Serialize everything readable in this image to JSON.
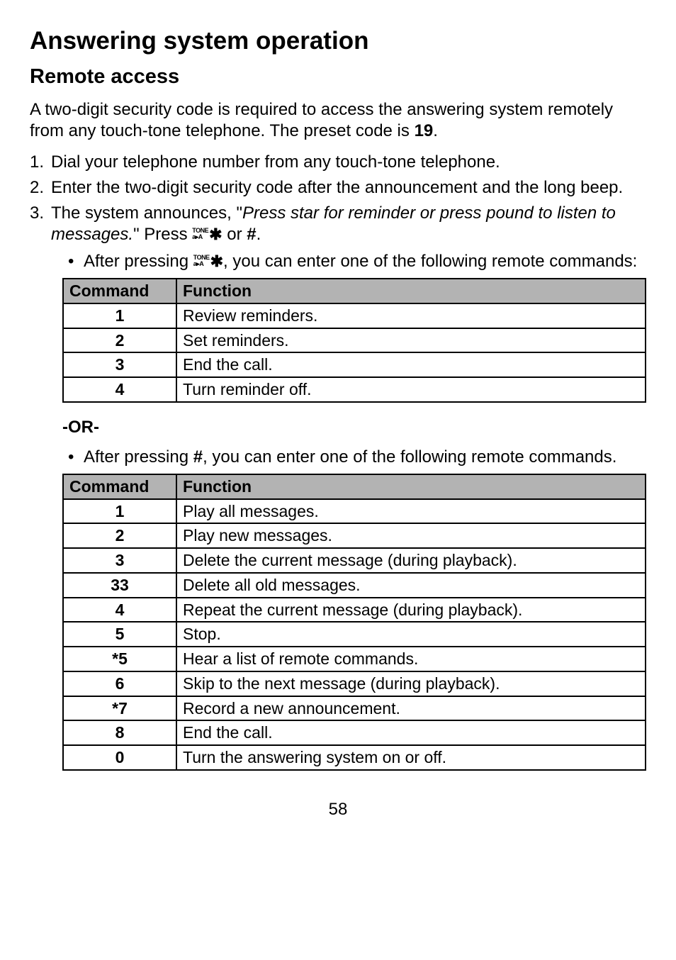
{
  "heading": "Answering system operation",
  "subheading": "Remote access",
  "intro_pre": "A two-digit security code is required to access the answering system remotely from any touch-tone telephone. The preset code is ",
  "intro_code": "19",
  "intro_post": ".",
  "steps": {
    "s1": "Dial your telephone number from any touch-tone telephone.",
    "s2": "Enter the two-digit security code after the announcement and the long beep.",
    "s3_pre": "The system announces, \"",
    "s3_quote": "Press star for reminder or press pound to listen to messages.",
    "s3_mid": "\" Press ",
    "s3_or": " or ",
    "s3_pound": "#",
    "s3_end": "."
  },
  "bullet1_pre": "After pressing ",
  "bullet1_post": ", you can enter one of the following remote commands:",
  "or_label": "-OR-",
  "bullet2_pre": "After pressing ",
  "bullet2_pound": "#",
  "bullet2_post": ", you can enter one of the following remote commands.",
  "table_headers": {
    "cmd": "Command",
    "fn": "Function"
  },
  "table1": [
    {
      "cmd": "1",
      "fn": "Review reminders."
    },
    {
      "cmd": "2",
      "fn": "Set reminders."
    },
    {
      "cmd": "3",
      "fn": "End the call."
    },
    {
      "cmd": "4",
      "fn": "Turn reminder off."
    }
  ],
  "table2": [
    {
      "cmd": "1",
      "fn": "Play all messages."
    },
    {
      "cmd": "2",
      "fn": "Play new messages."
    },
    {
      "cmd": "3",
      "fn": "Delete the current message (during playback)."
    },
    {
      "cmd": "33",
      "fn": "Delete all old messages."
    },
    {
      "cmd": "4",
      "fn": "Repeat the current message (during playback)."
    },
    {
      "cmd": "5",
      "fn": "Stop."
    },
    {
      "cmd": "*5",
      "fn": "Hear a list of remote commands."
    },
    {
      "cmd": "6",
      "fn": "Skip to the next message (during playback)."
    },
    {
      "cmd": "*7",
      "fn": "Record a new announcement."
    },
    {
      "cmd": "8",
      "fn": "End the call."
    },
    {
      "cmd": "0",
      "fn": "Turn the answering system on or off."
    }
  ],
  "tone_icon": {
    "top": "TONE",
    "bot": "a▸A"
  },
  "page_number": "58"
}
